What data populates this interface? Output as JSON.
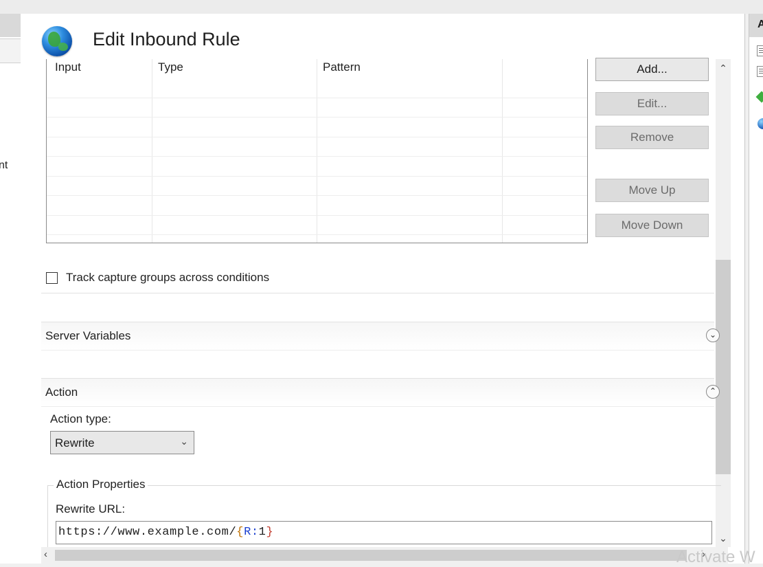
{
  "window": {
    "title": "Edit Inbound Rule"
  },
  "left_pane": {
    "clipped_text": "nt"
  },
  "conditions_grid": {
    "columns": [
      "Input",
      "Type",
      "Pattern",
      ""
    ],
    "rows": []
  },
  "condition_buttons": {
    "add": "Add...",
    "edit": "Edit...",
    "remove": "Remove",
    "move_up": "Move Up",
    "move_down": "Move Down"
  },
  "track_capture": {
    "label": "Track capture groups across conditions",
    "checked": false
  },
  "sections": {
    "server_variables": {
      "title": "Server Variables",
      "expanded": false
    },
    "action": {
      "title": "Action",
      "expanded": true
    }
  },
  "action": {
    "type_label": "Action type:",
    "type_value": "Rewrite",
    "properties_legend": "Action Properties",
    "rewrite_url_label": "Rewrite URL:",
    "rewrite_url": {
      "full": "https://www.example.com/{R:1}",
      "prefix": "https://www.example.com/",
      "open_brace": "{",
      "var": "R:",
      "num": "1",
      "close_brace": "}"
    }
  },
  "right_pane": {
    "clipped_header": "A"
  },
  "watermark": "Activate W",
  "colors": {
    "url_brace": "#c07000",
    "url_var": "#1a3fcf",
    "url_close": "#c0392b",
    "disabled_button_text": "#6b6b6b"
  },
  "icons": {
    "title": "globe-icon",
    "scroll_up": "chevron-up-icon",
    "scroll_down": "chevron-down-icon",
    "scroll_left": "chevron-left-icon",
    "scroll_right": "chevron-right-icon",
    "collapse": "chevron-circle-icon"
  }
}
